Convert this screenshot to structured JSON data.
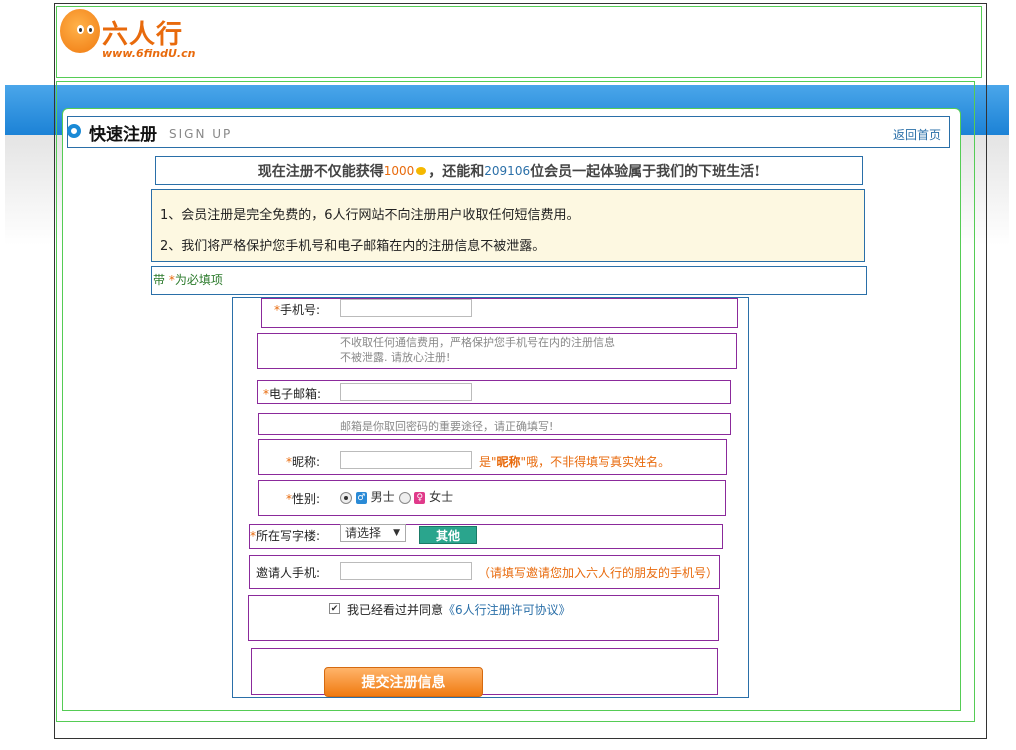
{
  "logo": {
    "cn": "六人行",
    "en": "www.6findU.cn"
  },
  "heading": {
    "title": "快速注册",
    "subtitle": "SIGN UP",
    "home_link": "返回首页"
  },
  "promo": {
    "part1": "现在注册不仅能获得",
    "points": "1000",
    "part2": "，还能和",
    "members": "209106",
    "part3": "位会员一起体验属于我们的下班生活!"
  },
  "notices": [
    "1、会员注册是完全免费的，6人行网站不向注册用户收取任何短信费用。",
    "2、我们将严格保护您手机号和电子邮箱在内的注册信息不被泄露。"
  ],
  "required_note": {
    "prefix": "带 ",
    "star": "*",
    "suffix": "为必填项"
  },
  "form": {
    "phone": {
      "label": "手机号:",
      "hint_line1": "不收取任何通信费用，严格保护您手机号在内的注册信息",
      "hint_line2": "不被泄露. 请放心注册!",
      "value": ""
    },
    "email": {
      "label": "电子邮箱:",
      "hint": "邮箱是你取回密码的重要途径，请正确填写!",
      "value": ""
    },
    "nickname": {
      "label": "昵称:",
      "hint_prefix": "是\"",
      "hint_bold": "昵称",
      "hint_suffix": "\"哦，不非得填写真实姓名。",
      "value": ""
    },
    "gender": {
      "label": "性别:",
      "male": "男士",
      "female": "女士",
      "selected": "male"
    },
    "building": {
      "label": "所在写字楼:",
      "select_value": "请选择",
      "other_button": "其他"
    },
    "inviter": {
      "label": "邀请人手机:",
      "hint": "（请填写邀请您加入六人行的朋友的手机号）",
      "value": ""
    },
    "agreement": {
      "text": "我已经看过并同意",
      "link": "《6人行注册许可协议》",
      "checked": true
    },
    "submit": "提交注册信息",
    "star": "*"
  }
}
